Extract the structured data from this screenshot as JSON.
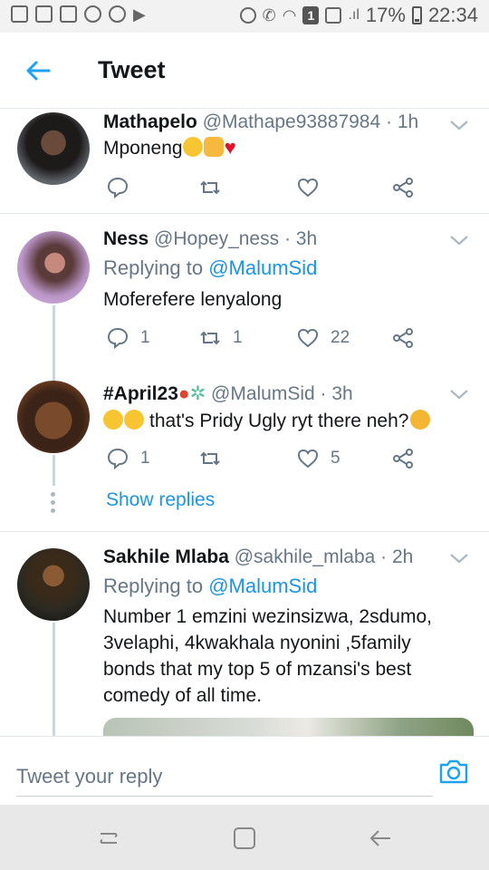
{
  "status_bar": {
    "battery": "17%",
    "time": "22:34",
    "sim_badge": "1"
  },
  "header": {
    "title": "Tweet"
  },
  "tweets": [
    {
      "name": "Mathapelo",
      "handle": "@Mathape93887984",
      "time": "· 1h",
      "text": "Mponeng",
      "emojis": [
        "crying-face",
        "victory-hand",
        "red-heart"
      ],
      "replies": "",
      "retweets": "",
      "likes": ""
    },
    {
      "name": "Ness",
      "handle": "@Hopey_ness",
      "time": "· 3h",
      "reply_prefix": "Replying to",
      "reply_to": "@MalumSid",
      "text": "Moferefere lenyalong",
      "replies": "1",
      "retweets": "1",
      "likes": "22"
    },
    {
      "name": "#April23",
      "name_emojis": [
        "balloon",
        "fairy"
      ],
      "handle": "@MalumSid",
      "time": "· 3h",
      "text_emojis": [
        "rolling-laughing",
        "rolling-laughing"
      ],
      "text": "that's Pridy Ugly ryt there neh?",
      "text_emoji_end": "thinking-face",
      "replies": "1",
      "retweets": "",
      "likes": "5",
      "show_replies": "Show replies"
    },
    {
      "name": "Sakhile Mlaba",
      "handle": "@sakhile_mlaba",
      "time": "· 2h",
      "reply_prefix": "Replying to",
      "reply_to": "@MalumSid",
      "text": "Number 1 emzini wezinsizwa, 2sdumo, 3velaphi, 4kwakhala nyonini ,5family bonds that my top 5 of mzansi's best comedy of all time."
    }
  ],
  "composer": {
    "placeholder": "Tweet your reply"
  },
  "colors": {
    "accent": "#1b95e0",
    "text": "#14171a",
    "secondary": "#657786",
    "like_icon": "#e0245e"
  }
}
